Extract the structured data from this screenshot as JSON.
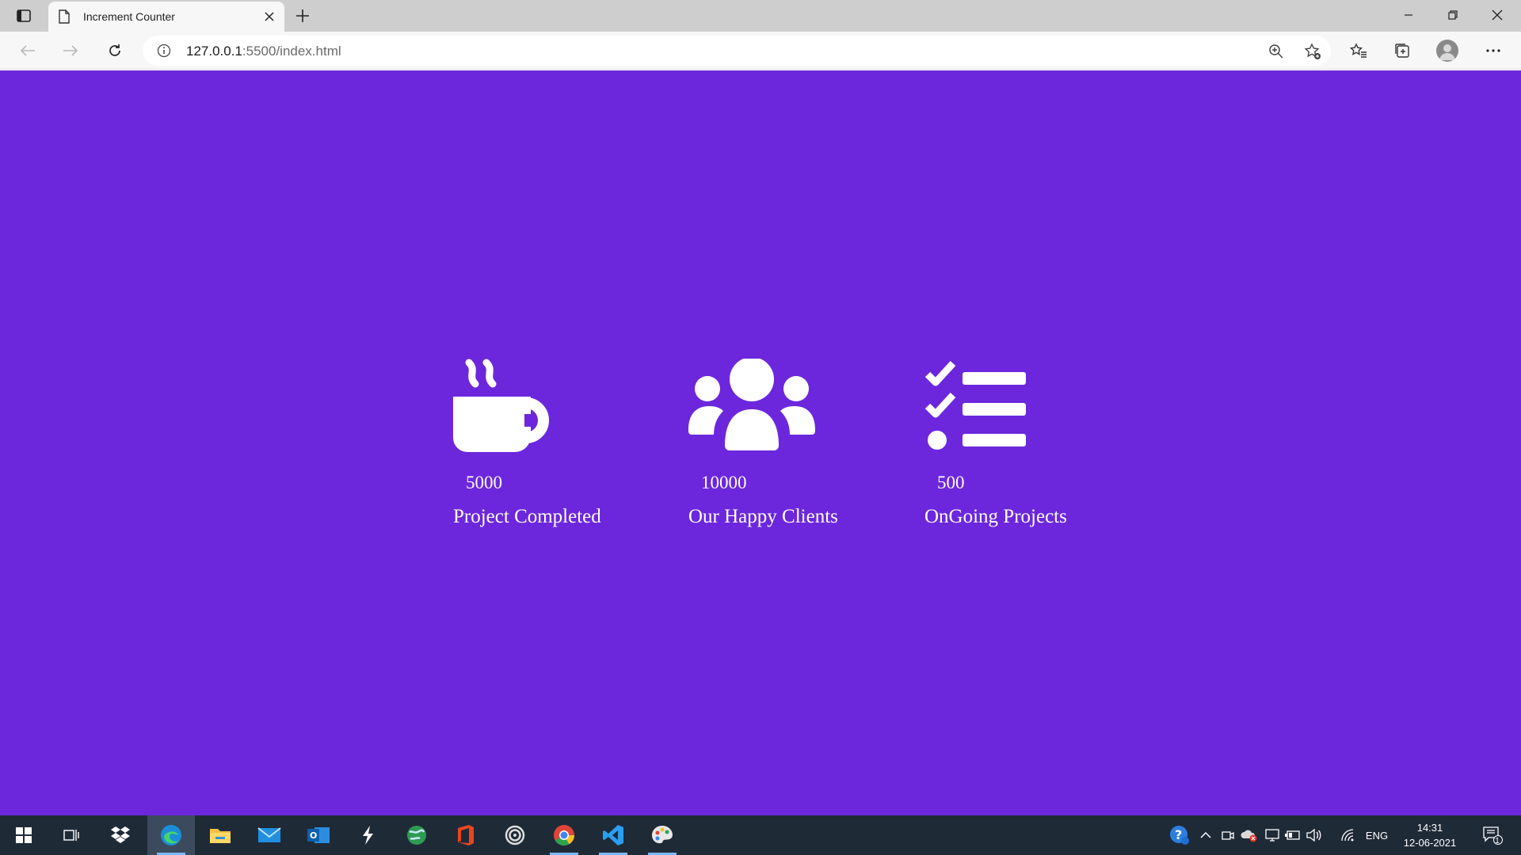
{
  "browser": {
    "tab": {
      "title": "Increment Counter"
    },
    "url": {
      "host": "127.0.0.1",
      "rest": ":5500/index.html"
    }
  },
  "page": {
    "background": "#6c27dc",
    "counters": [
      {
        "icon": "coffee-mug-icon",
        "value": "5000",
        "label": "Project Completed"
      },
      {
        "icon": "users-group-icon",
        "value": "10000",
        "label": "Our Happy Clients"
      },
      {
        "icon": "task-list-icon",
        "value": "500",
        "label": "OnGoing Projects"
      }
    ]
  },
  "taskbar": {
    "tray": {
      "language": "ENG",
      "notification_count": "1"
    },
    "clock": {
      "time": "14:31",
      "date": "12-06-2021"
    }
  }
}
